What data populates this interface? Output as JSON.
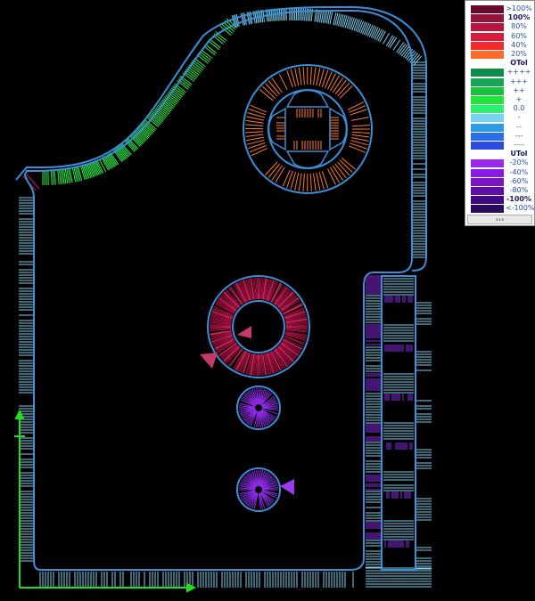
{
  "legend": {
    "toggle_label": "›››",
    "items": [
      {
        "label": ">100%",
        "color": "#6a0a2e",
        "label_color": "#2a50a8",
        "bold": false
      },
      {
        "label": "100%",
        "color": "#93123a",
        "label_color": "#1a1a5a",
        "bold": true
      },
      {
        "label": "80%",
        "color": "#b8133c",
        "label_color": "#2a50a8",
        "bold": false
      },
      {
        "label": "60%",
        "color": "#d81b3a",
        "label_color": "#2a50a8",
        "bold": false
      },
      {
        "label": "40%",
        "color": "#f02a2a",
        "label_color": "#2a50a8",
        "bold": false
      },
      {
        "label": "20%",
        "color": "#ff6a28",
        "label_color": "#2a50a8",
        "bold": false
      },
      {
        "label": "OTol",
        "color": "#ffffff",
        "label_color": "#1a1a5a",
        "bold": true
      },
      {
        "label": "++++",
        "color": "#128c4a",
        "label_color": "#2a50a8",
        "bold": false
      },
      {
        "label": "+++",
        "color": "#14a650",
        "label_color": "#2a50a8",
        "bold": false
      },
      {
        "label": "++",
        "color": "#19c23c",
        "label_color": "#2a50a8",
        "bold": false
      },
      {
        "label": "+",
        "color": "#22e63a",
        "label_color": "#2a50a8",
        "bold": false
      },
      {
        "label": "0.0",
        "color": "#2cf070",
        "label_color": "#2a50a8",
        "bold": false
      },
      {
        "label": "-",
        "color": "#78d2f0",
        "label_color": "#2a50a8",
        "bold": false
      },
      {
        "label": "--",
        "color": "#2f9be6",
        "label_color": "#2a50a8",
        "bold": false
      },
      {
        "label": "---",
        "color": "#2a6ee8",
        "label_color": "#2a50a8",
        "bold": false
      },
      {
        "label": "----",
        "color": "#2a4ce0",
        "label_color": "#2a50a8",
        "bold": false
      },
      {
        "label": "UTol",
        "color": "#ffffff",
        "label_color": "#1a1a5a",
        "bold": true
      },
      {
        "label": "-20%",
        "color": "#9b28ee",
        "label_color": "#2a50a8",
        "bold": false
      },
      {
        "label": "-40%",
        "color": "#8a1ae0",
        "label_color": "#2a50a8",
        "bold": false
      },
      {
        "label": "-60%",
        "color": "#7a14c8",
        "label_color": "#2a50a8",
        "bold": false
      },
      {
        "label": "-80%",
        "color": "#5e0ea8",
        "label_color": "#2a50a8",
        "bold": false
      },
      {
        "label": "-100%",
        "color": "#3e0a84",
        "label_color": "#1a1a5a",
        "bold": true
      },
      {
        "label": "<-100%",
        "color": "#2a0a60",
        "label_color": "#2a50a8",
        "bold": false
      }
    ]
  },
  "colors": {
    "background": "#000000",
    "outline": "#3a8fd8",
    "light_blue": "#7ecfee",
    "green": "#2ee84a",
    "orange": "#ff7a2e",
    "crimson": "#a0103e",
    "violet": "#8a2be2",
    "axis_green": "#22dd22"
  },
  "features": [
    {
      "name": "outer-profile",
      "deviation_level": "-"
    },
    {
      "name": "arc-edge",
      "deviation_level": "++"
    },
    {
      "name": "top-circle-slots",
      "deviation_level": "20%"
    },
    {
      "name": "large-ring",
      "deviation_level": "80%"
    },
    {
      "name": "small-hole-upper",
      "deviation_level": "-40%"
    },
    {
      "name": "small-hole-lower",
      "deviation_level": "-40%"
    },
    {
      "name": "right-notched-strip",
      "deviation_level": "-40%"
    }
  ]
}
